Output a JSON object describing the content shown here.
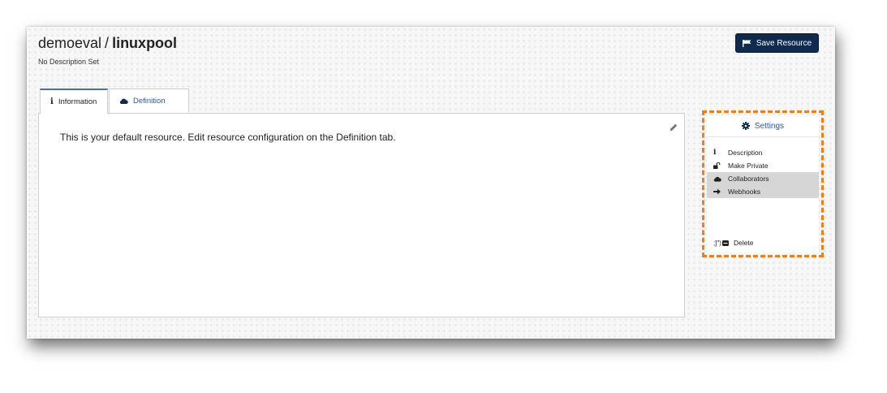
{
  "header": {
    "owner": "demoeval",
    "separator": "/",
    "resource_name": "linuxpool",
    "description": "No Description Set",
    "save_button_label": "Save Resource"
  },
  "tabs": [
    {
      "label": "Information",
      "icon": "info-icon",
      "active": true
    },
    {
      "label": "Definition",
      "icon": "cloud-icon",
      "active": false
    }
  ],
  "panel": {
    "text": "This is your default resource. Edit resource configuration on the Definition tab.",
    "edit_icon": "pencil-icon"
  },
  "settings": {
    "header_label": "Settings",
    "header_icon": "gear-icon",
    "items": [
      {
        "label": "Description",
        "icon": "info-icon",
        "highlighted": false
      },
      {
        "label": "Make Private",
        "icon": "unlock-icon",
        "highlighted": false
      },
      {
        "label": "Collaborators",
        "icon": "cloud-icon",
        "highlighted": true
      },
      {
        "label": "Webhooks",
        "icon": "arrow-right-icon",
        "highlighted": true
      }
    ],
    "delete_glyph": ";]\")",
    "delete_label": "Delete",
    "delete_icon": "trash-icon"
  },
  "colors": {
    "accent_dashed_border": "#f07c1a",
    "primary_button": "#102b4e",
    "link_blue": "#2a57a8"
  }
}
